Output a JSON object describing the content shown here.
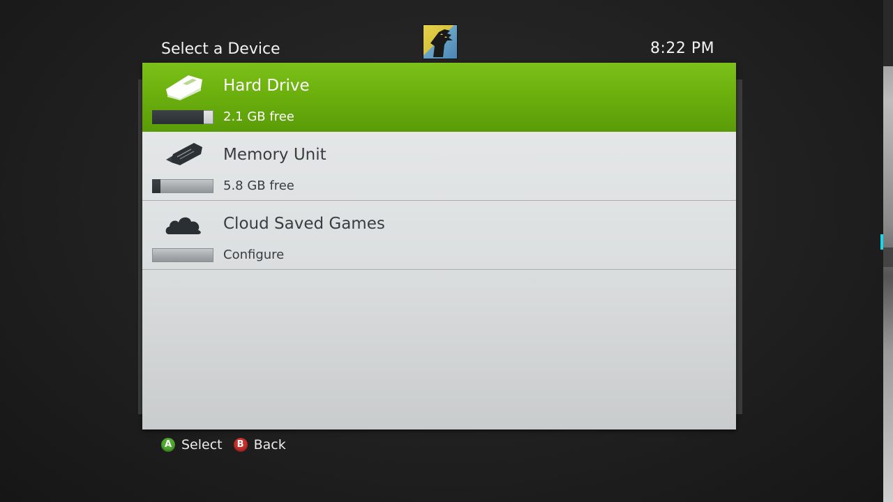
{
  "header": {
    "title": "Select a Device",
    "clock": "8:22  PM"
  },
  "colors": {
    "accent_green": "#6cb00e",
    "button_a": "#4faa2e",
    "button_b": "#c9302c"
  },
  "devices": [
    {
      "name": "Hard Drive",
      "status": "2.1 GB free",
      "icon": "hard-drive-icon",
      "used_fraction": 0.84,
      "selected": true
    },
    {
      "name": "Memory Unit",
      "status": "5.8 GB free",
      "icon": "usb-drive-icon",
      "used_fraction": 0.14,
      "selected": false
    },
    {
      "name": "Cloud Saved Games",
      "status": "Configure",
      "icon": "cloud-icon",
      "used_fraction": 0,
      "selected": false
    }
  ],
  "footer": {
    "a_glyph": "A",
    "a_label": "Select",
    "b_glyph": "B",
    "b_label": "Back"
  }
}
